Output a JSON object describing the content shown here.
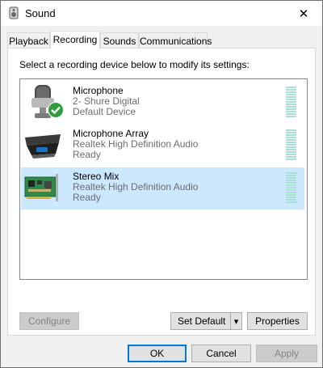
{
  "window": {
    "title": "Sound",
    "close_glyph": "✕",
    "icon": "speaker-icon"
  },
  "tabs": [
    {
      "label": "Playback",
      "active": false
    },
    {
      "label": "Recording",
      "active": true
    },
    {
      "label": "Sounds",
      "active": false
    },
    {
      "label": "Communications",
      "active": false
    }
  ],
  "panel": {
    "instructions": "Select a recording device below to modify its settings:",
    "devices": [
      {
        "name": "Microphone",
        "line1": "2- Shure Digital",
        "line2": "Default Device",
        "icon": "microphone-icon",
        "default_check": true,
        "selected": false
      },
      {
        "name": "Microphone Array",
        "line1": "Realtek High Definition Audio",
        "line2": "Ready",
        "icon": "microphone-array-icon",
        "default_check": false,
        "selected": false
      },
      {
        "name": "Stereo Mix",
        "line1": "Realtek High Definition Audio",
        "line2": "Ready",
        "icon": "sound-card-icon",
        "default_check": false,
        "selected": true
      }
    ],
    "buttons": {
      "configure": "Configure",
      "set_default": "Set Default",
      "set_default_arrow": "▾",
      "properties": "Properties"
    }
  },
  "footer": {
    "ok": "OK",
    "cancel": "Cancel",
    "apply": "Apply"
  },
  "colors": {
    "selection": "#cce8ff",
    "accent": "#0078d7",
    "meter": "#a9dfd6",
    "check": "#2e9e3b"
  }
}
